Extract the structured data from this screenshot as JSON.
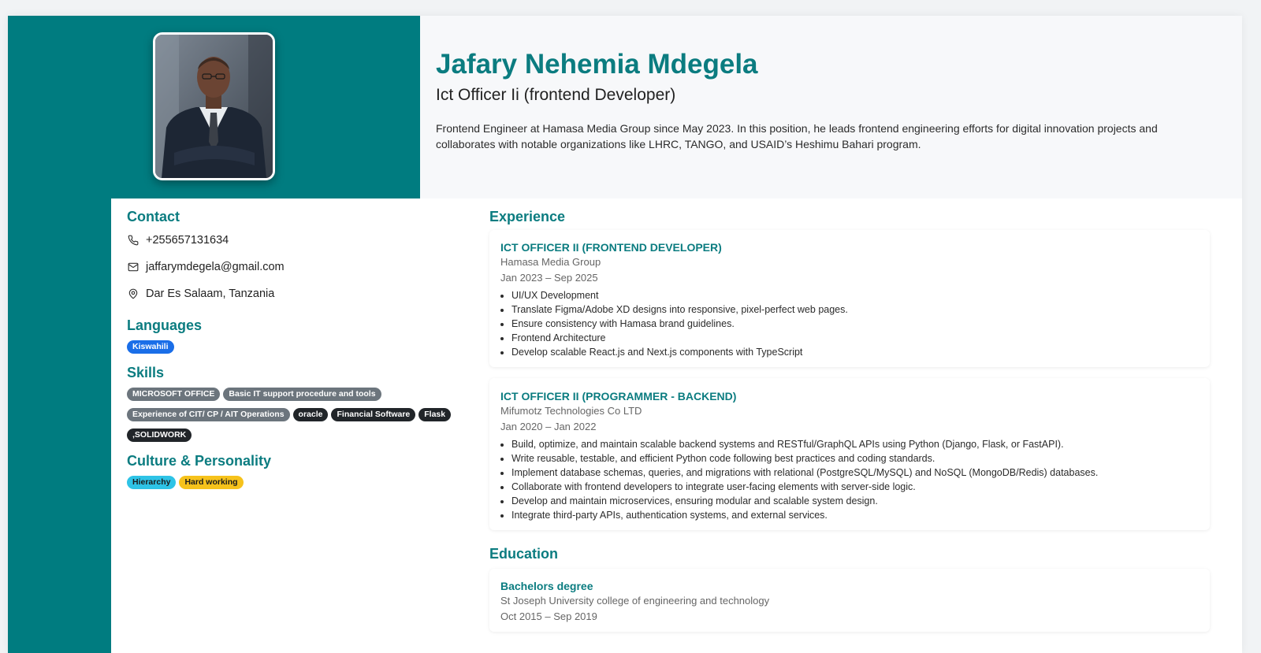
{
  "profile": {
    "name": "Jafary Nehemia Mdegela",
    "title": "Ict Officer Ii (frontend Developer)",
    "summary": "Frontend Engineer at Hamasa Media Group since May 2023. In this position, he leads frontend engineering efforts for digital innovation projects and collaborates with notable organizations like LHRC, TANGO, and USAID’s Heshimu Bahari program."
  },
  "contact": {
    "heading": "Contact",
    "phone": "+255657131634",
    "email": "jaffarymdegela@gmail.com",
    "location": "Dar Es Salaam, Tanzania"
  },
  "languages": {
    "heading": "Languages",
    "items": [
      "Kiswahili"
    ]
  },
  "skills": {
    "heading": "Skills",
    "items": [
      "MICROSOFT OFFICE",
      "Basic IT support procedure and tools",
      "Experience of CIT/ CP / AIT Operations",
      "oracle",
      "Financial Software",
      "Flask",
      ",SOLIDWORK"
    ]
  },
  "culture": {
    "heading": "Culture & Personality",
    "items": [
      "Hierarchy",
      "Hard working"
    ]
  },
  "experience": {
    "heading": "Experience",
    "jobs": [
      {
        "title": "ICT OFFICER II (FRONTEND DEVELOPER)",
        "company": "Hamasa Media Group",
        "dates": "Jan 2023 – Sep 2025",
        "bullets": [
          "UI/UX Development",
          "Translate Figma/Adobe XD designs into responsive, pixel-perfect web pages.",
          "Ensure consistency with Hamasa brand guidelines.",
          "Frontend Architecture",
          "Develop scalable React.js and Next.js components with TypeScript"
        ]
      },
      {
        "title": "ICT OFFICER II (PROGRAMMER - BACKEND)",
        "company": "Mifumotz Technologies Co LTD",
        "dates": "Jan 2020 – Jan 2022",
        "bullets": [
          "Build, optimize, and maintain scalable backend systems and RESTful/GraphQL APIs using Python (Django, Flask, or FastAPI).",
          "Write reusable, testable, and efficient Python code following best practices and coding standards.",
          "Implement database schemas, queries, and migrations with relational (PostgreSQL/MySQL) and NoSQL (MongoDB/Redis) databases.",
          "Collaborate with frontend developers to integrate user-facing elements with server-side logic.",
          "Develop and maintain microservices, ensuring modular and scalable system design.",
          "Integrate third-party APIs, authentication systems, and external services."
        ]
      }
    ]
  },
  "education": {
    "heading": "Education",
    "items": [
      {
        "degree": "Bachelors degree",
        "school": "St Joseph University college of engineering and technology",
        "dates": "Oct 2015 – Sep 2019"
      }
    ]
  },
  "colors": {
    "teal": "#007c80",
    "accent_text": "#0b7c80",
    "language_pill": "#1a6ee8",
    "skill_pill_gray": "#6c757d",
    "skill_pill_dark": "#212529",
    "culture_pill_cyan": "#2ec3e6",
    "culture_pill_yellow": "#f6c21b"
  }
}
